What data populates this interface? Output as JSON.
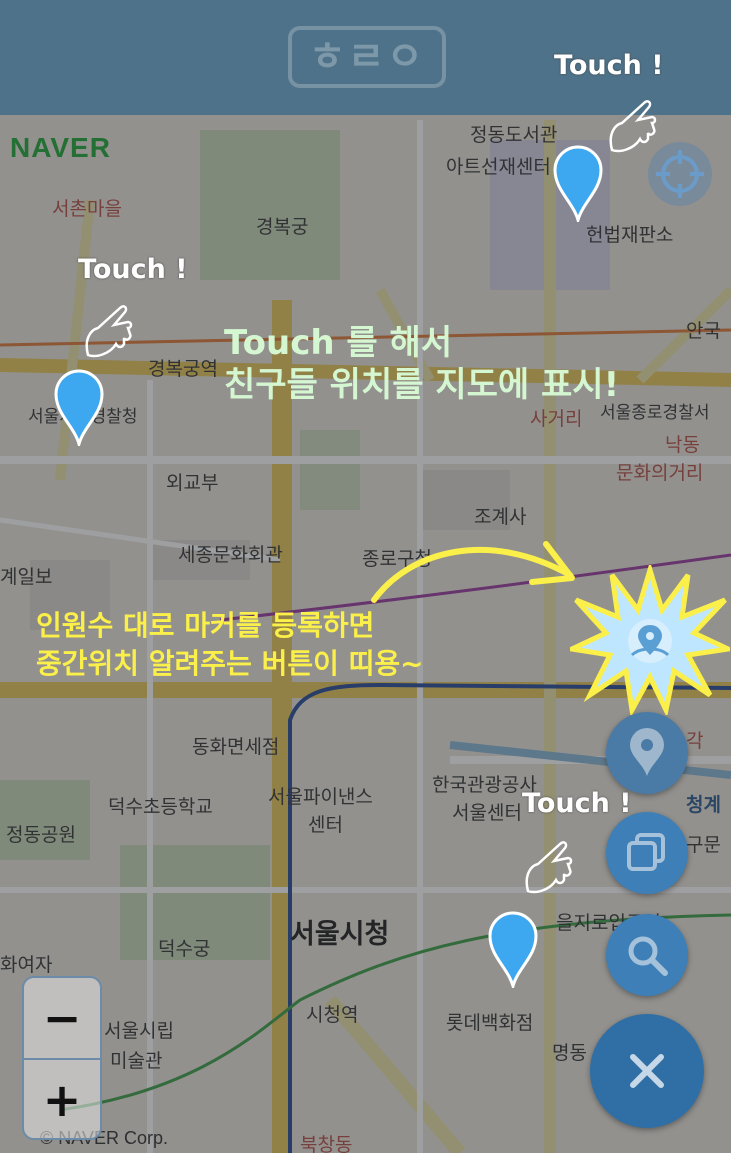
{
  "app": {
    "logo_text": "ㅎㄹㅇ",
    "provider_logo": "NAVER",
    "copyright": "© NAVER Corp."
  },
  "map": {
    "labels": [
      "정동도서관",
      "아트선재센터",
      "헌법재판소",
      "서촌마을",
      "경복궁",
      "경복궁역",
      "서울지방경찰청",
      "안국",
      "외교부",
      "조계사",
      "세종문화회관",
      "종로구청",
      "계일보",
      "사거리",
      "서울종로경찰서",
      "낙동",
      "문화의거리",
      "동화면세점",
      "한국관광공사",
      "서울센터",
      "서울파이낸스",
      "센터",
      "덕수초등학교",
      "정동공원",
      "서울시청",
      "덕수궁",
      "시청역",
      "롯데백화점",
      "을지로입구역",
      "서울시립",
      "미술관",
      "화여자",
      "각",
      "청계",
      "구문",
      "명동",
      "북창동"
    ]
  },
  "overlay": {
    "touch_label": "Touch !",
    "caption_top": [
      "Touch 를 해서",
      "친구들 위치를 지도에 표시!"
    ],
    "caption_mid": [
      "인원수 대로 마커를 등록하면",
      "중간위치 알려주는 버튼이 띠용~"
    ]
  },
  "controls": {
    "zoom_out": "−",
    "zoom_in": "+",
    "icons": [
      "crosshair-icon",
      "location-pin-icon",
      "copy-layers-icon",
      "search-icon",
      "close-icon"
    ]
  },
  "colors": {
    "header": "#4e7289",
    "pin": "#3da7f0",
    "fab": "#3d7fb6",
    "caption_top": "#d4f7d2",
    "caption_mid": "#fbef4a"
  }
}
